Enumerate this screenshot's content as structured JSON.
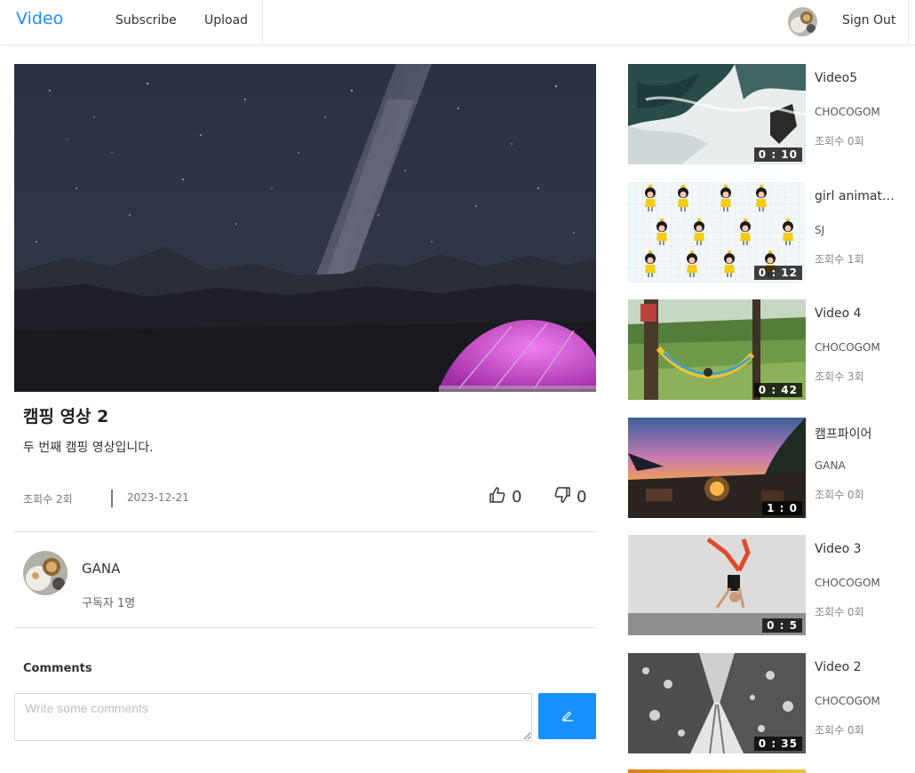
{
  "header": {
    "logo": "Video",
    "nav": [
      "Subscribe",
      "Upload"
    ],
    "signout": "Sign Out",
    "accent_color": "#1890ff"
  },
  "video": {
    "title": "캠핑 영상 2",
    "description": "두 번째 캠핑 영상입니다.",
    "views": "조회수 2회",
    "date": "2023-12-21",
    "likes": "0",
    "dislikes": "0",
    "like_icon": "thumbs-up-icon",
    "dislike_icon": "thumbs-down-icon"
  },
  "channel": {
    "name": "GANA",
    "subscribers": "구독자 1명"
  },
  "comments": {
    "label": "Comments",
    "placeholder": "Write some comments",
    "submit_icon": "edit-icon"
  },
  "sidebar": {
    "items": [
      {
        "title": "Video5",
        "channel": "CHOCOGOM",
        "views": "조회수 0회",
        "duration": "0 : 10"
      },
      {
        "title": "girl animation",
        "channel": "SJ",
        "views": "조회수 1회",
        "duration": "0 : 12"
      },
      {
        "title": "Video 4",
        "channel": "CHOCOGOM",
        "views": "조회수 3회",
        "duration": "0 : 42"
      },
      {
        "title": "캠프파이어",
        "channel": "GANA",
        "views": "조회수 0회",
        "duration": "1 : 0"
      },
      {
        "title": "Video 3",
        "channel": "CHOCOGOM",
        "views": "조회수 0회",
        "duration": "0 : 5"
      },
      {
        "title": "Video 2",
        "channel": "CHOCOGOM",
        "views": "조회수 0회",
        "duration": "0 : 35"
      }
    ]
  }
}
